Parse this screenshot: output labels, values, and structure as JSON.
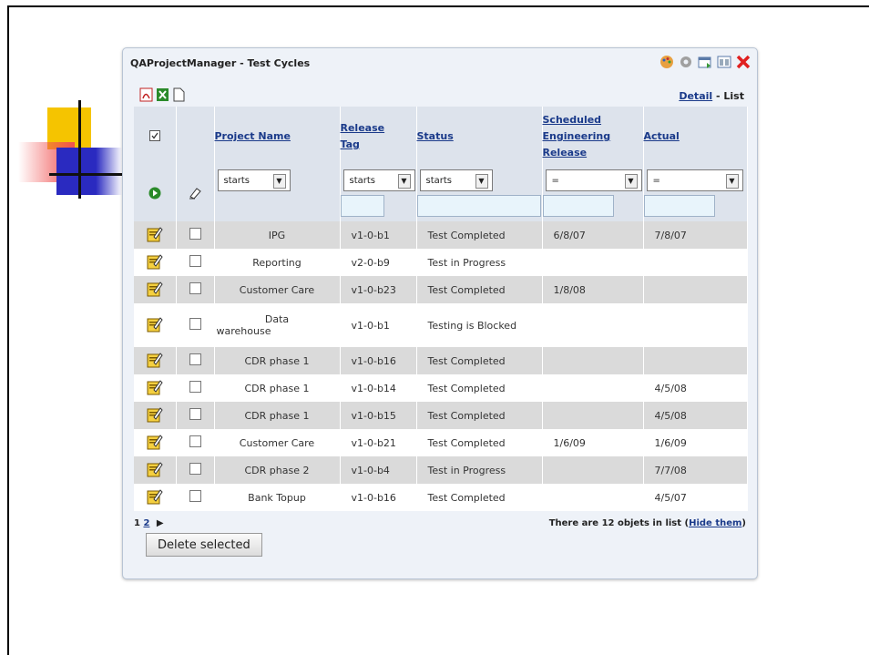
{
  "window": {
    "title": "QAProjectManager - Test Cycles"
  },
  "view_switch": {
    "detail": "Detail",
    "separator": " - ",
    "list": "List"
  },
  "columns": {
    "project_name": "Project Name",
    "release_tag": [
      "Release",
      "Tag"
    ],
    "status": "Status",
    "scheduled": [
      "Scheduled",
      "Engineering",
      "Release"
    ],
    "actual": "Actual"
  },
  "filters": {
    "project_name": "starts",
    "release_tag": "starts",
    "status": "starts",
    "scheduled": "=",
    "actual": "="
  },
  "rows": [
    {
      "name": "IPG",
      "tag": "v1-0-b1",
      "status": "Test Completed",
      "scheduled": "6/8/07",
      "actual": "7/8/07"
    },
    {
      "name": "Reporting",
      "tag": "v2-0-b9",
      "status": "Test in Progress",
      "scheduled": "",
      "actual": ""
    },
    {
      "name": "Customer Care",
      "tag": "v1-0-b23",
      "status": "Test Completed",
      "scheduled": "1/8/08",
      "actual": ""
    },
    {
      "name_lines": [
        "Data",
        "warehouse"
      ],
      "tag": "v1-0-b1",
      "status": "Testing is Blocked",
      "scheduled": "",
      "actual": ""
    },
    {
      "name": "CDR phase 1",
      "tag": "v1-0-b16",
      "status": "Test Completed",
      "scheduled": "",
      "actual": ""
    },
    {
      "name": "CDR phase 1",
      "tag": "v1-0-b14",
      "status": "Test Completed",
      "scheduled": "",
      "actual": "4/5/08"
    },
    {
      "name": "CDR phase 1",
      "tag": "v1-0-b15",
      "status": "Test Completed",
      "scheduled": "",
      "actual": "4/5/08"
    },
    {
      "name": "Customer Care",
      "tag": "v1-0-b21",
      "status": "Test Completed",
      "scheduled": "1/6/09",
      "actual": "1/6/09"
    },
    {
      "name": "CDR phase 2",
      "tag": "v1-0-b4",
      "status": "Test in Progress",
      "scheduled": "",
      "actual": "7/7/08"
    },
    {
      "name": "Bank Topup",
      "tag": "v1-0-b16",
      "status": "Test Completed",
      "scheduled": "",
      "actual": "4/5/07"
    }
  ],
  "pagination": {
    "page1": "1",
    "page2": "2",
    "next": "▶"
  },
  "footer": {
    "count_text": "There are 12 objets in list (",
    "hide_link": "Hide them",
    "close_paren": ")"
  },
  "actions": {
    "delete_selected": "Delete selected"
  },
  "icons": [
    "pdf-icon",
    "excel-icon",
    "document-icon",
    "palette-icon",
    "gear-icon",
    "export-icon",
    "window-icon",
    "close-icon",
    "go-icon",
    "eraser-icon",
    "edit-icon"
  ]
}
